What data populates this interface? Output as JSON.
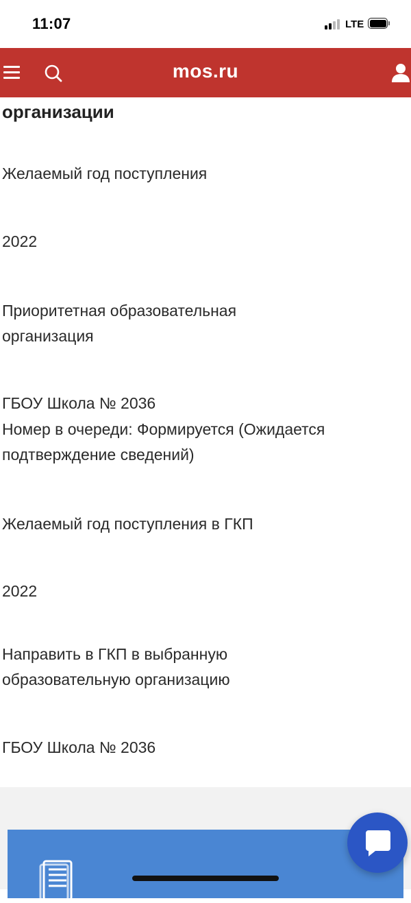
{
  "status_bar": {
    "time": "11:07",
    "network": "LTE",
    "signal_bars_active": 2,
    "signal_bars_total": 4
  },
  "header": {
    "logo": "mos.ru",
    "background_color": "#bf342e",
    "icons": [
      "menu-icon",
      "search-icon",
      "user-icon"
    ]
  },
  "main": {
    "section_title": "организации",
    "fields": [
      {
        "label": "Желаемый год поступления"
      },
      {
        "value": "2022"
      },
      {
        "label": "Приоритетная образовательная организация"
      },
      {
        "value_line1": "ГБОУ Школа № 2036",
        "value_line2": "Номер в очереди: Формируется (Ожидается подтверждение сведений)"
      },
      {
        "label": "Желаемый год поступления в ГКП"
      },
      {
        "value": "2022"
      },
      {
        "label": "Направить в ГКП в выбранную образовательную организацию"
      },
      {
        "value": "ГБОУ Школа № 2036"
      }
    ]
  },
  "footer": {
    "card_color": "#4a86d3",
    "card_icon": "document-icon",
    "chat_icon": "chat-bubble-icon",
    "chat_color": "#2b56c5"
  }
}
